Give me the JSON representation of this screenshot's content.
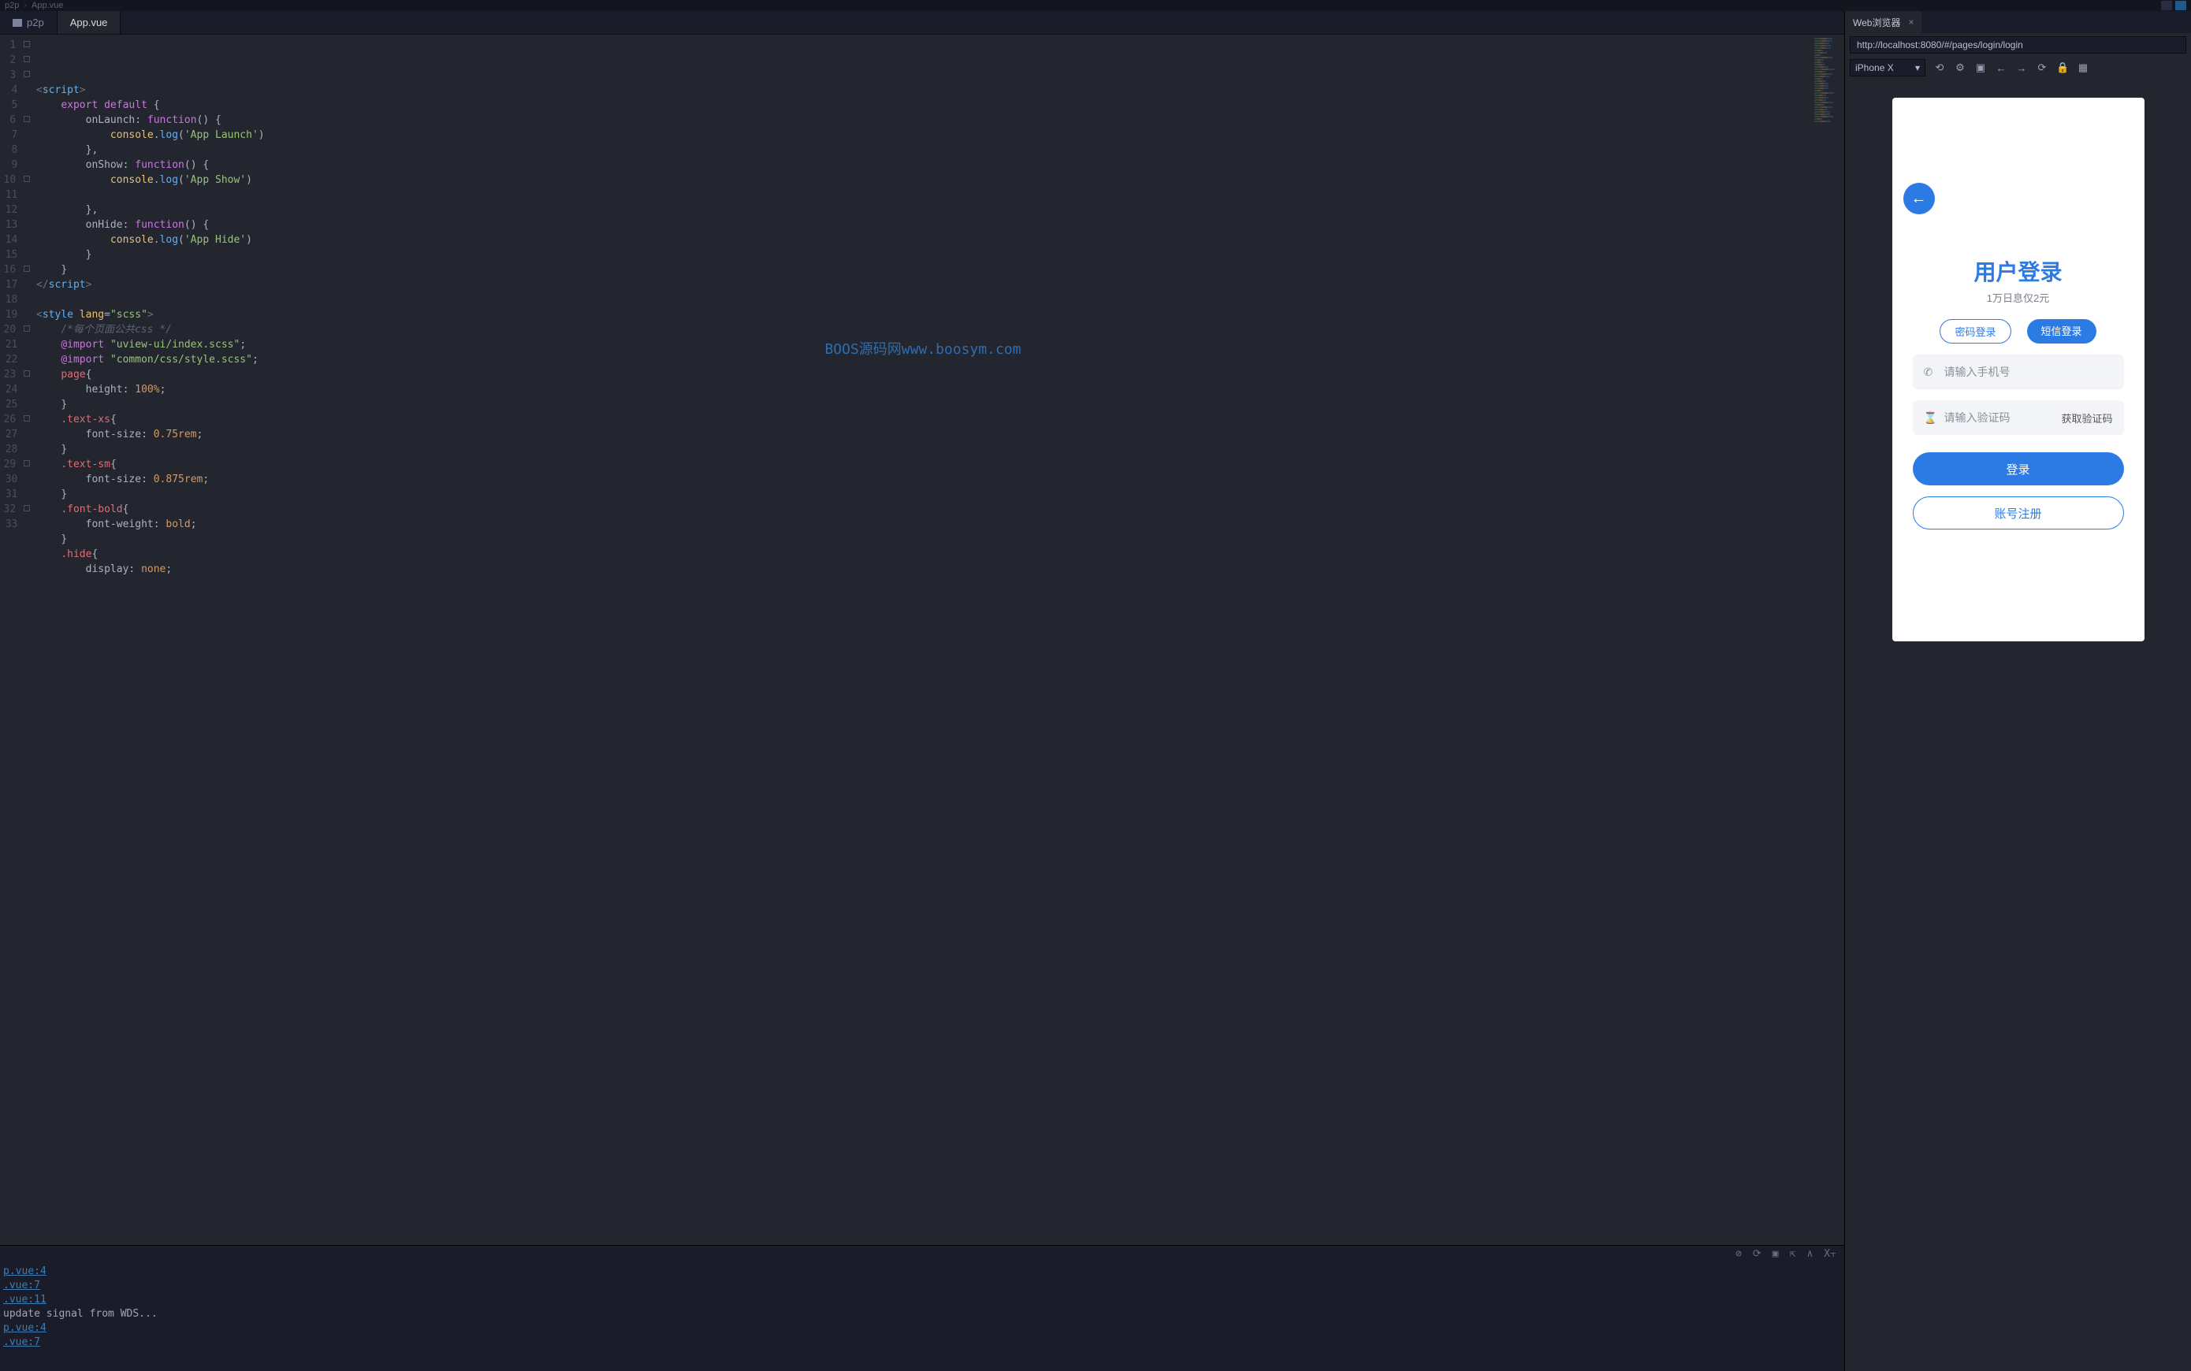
{
  "breadcrumb": {
    "root": "p2p",
    "file": "App.vue"
  },
  "tabs": {
    "items": [
      {
        "label": "p2p",
        "kind": "folder"
      },
      {
        "label": "App.vue",
        "active": true
      }
    ]
  },
  "editor": {
    "lines": [
      {
        "n": 1,
        "fold": true,
        "html": "<span class='tk-angle'>&lt;</span><span class='tk-tag'>script</span><span class='tk-angle'>&gt;</span>"
      },
      {
        "n": 2,
        "fold": true,
        "html": "    <span class='tk-keyword'>export</span> <span class='tk-keyword'>default</span> <span class='tk-punc'>{</span>"
      },
      {
        "n": 3,
        "fold": true,
        "html": "        <span class='tk-prop'>onLaunch</span>: <span class='tk-keyword'>function</span><span class='tk-punc'>() {</span>"
      },
      {
        "n": 4,
        "fold": false,
        "html": "            <span class='tk-builtin'>console</span>.<span class='tk-func'>log</span>(<span class='tk-string'>'App Launch'</span>)"
      },
      {
        "n": 5,
        "fold": false,
        "html": "        <span class='tk-punc'>},</span>"
      },
      {
        "n": 6,
        "fold": true,
        "html": "        <span class='tk-prop'>onShow</span>: <span class='tk-keyword'>function</span><span class='tk-punc'>() {</span>"
      },
      {
        "n": 7,
        "fold": false,
        "html": "            <span class='tk-builtin'>console</span>.<span class='tk-func'>log</span>(<span class='tk-string'>'App Show'</span>)"
      },
      {
        "n": 8,
        "fold": false,
        "html": ""
      },
      {
        "n": 9,
        "fold": false,
        "html": "        <span class='tk-punc'>},</span>"
      },
      {
        "n": 10,
        "fold": true,
        "html": "        <span class='tk-prop'>onHide</span>: <span class='tk-keyword'>function</span><span class='tk-punc'>() {</span>"
      },
      {
        "n": 11,
        "fold": false,
        "html": "            <span class='tk-builtin'>console</span>.<span class='tk-func'>log</span>(<span class='tk-string'>'App Hide'</span>)"
      },
      {
        "n": 12,
        "fold": false,
        "html": "        <span class='tk-punc'>}</span>"
      },
      {
        "n": 13,
        "fold": false,
        "html": "    <span class='tk-punc'>}</span>"
      },
      {
        "n": 14,
        "fold": false,
        "html": "<span class='tk-angle'>&lt;/</span><span class='tk-tag'>script</span><span class='tk-angle'>&gt;</span>"
      },
      {
        "n": 15,
        "fold": false,
        "html": ""
      },
      {
        "n": 16,
        "fold": true,
        "html": "<span class='tk-angle'>&lt;</span><span class='tk-tag'>style</span> <span class='tk-attr-name'>lang</span>=<span class='tk-attr-val'>\"scss\"</span><span class='tk-angle'>&gt;</span>"
      },
      {
        "n": 17,
        "fold": false,
        "html": "    <span class='tk-comment'>/*每个页面公共css */</span>"
      },
      {
        "n": 18,
        "fold": false,
        "html": "    <span class='tk-at'>@import</span> <span class='tk-string'>\"uview-ui/index.scss\"</span>;"
      },
      {
        "n": 19,
        "fold": false,
        "html": "    <span class='tk-at'>@import</span> <span class='tk-string'>\"common/css/style.scss\"</span>;"
      },
      {
        "n": 20,
        "fold": true,
        "html": "    <span class='tk-selector'>page</span><span class='tk-punc'>{</span>"
      },
      {
        "n": 21,
        "fold": false,
        "html": "        <span class='tk-cssprop'>height</span>: <span class='tk-cssval'>100%</span>;"
      },
      {
        "n": 22,
        "fold": false,
        "html": "    <span class='tk-punc'>}</span>"
      },
      {
        "n": 23,
        "fold": true,
        "html": "    <span class='tk-selector'>.text-xs</span><span class='tk-punc'>{</span>"
      },
      {
        "n": 24,
        "fold": false,
        "html": "        <span class='tk-cssprop'>font-size</span>: <span class='tk-cssval'>0.75rem</span>;"
      },
      {
        "n": 25,
        "fold": false,
        "html": "    <span class='tk-punc'>}</span>"
      },
      {
        "n": 26,
        "fold": true,
        "html": "    <span class='tk-selector'>.text-sm</span><span class='tk-punc'>{</span>"
      },
      {
        "n": 27,
        "fold": false,
        "html": "        <span class='tk-cssprop'>font-size</span>: <span class='tk-cssval'>0.875rem</span>;"
      },
      {
        "n": 28,
        "fold": false,
        "html": "    <span class='tk-punc'>}</span>"
      },
      {
        "n": 29,
        "fold": true,
        "html": "    <span class='tk-selector'>.font-bold</span><span class='tk-punc'>{</span>"
      },
      {
        "n": 30,
        "fold": false,
        "html": "        <span class='tk-cssprop'>font-weight</span>: <span class='tk-cssval'>bold</span>;"
      },
      {
        "n": 31,
        "fold": false,
        "html": "    <span class='tk-punc'>}</span>"
      },
      {
        "n": 32,
        "fold": true,
        "html": "    <span class='tk-selector'>.hide</span><span class='tk-punc'>{</span>"
      },
      {
        "n": 33,
        "fold": false,
        "html": "        <span class='tk-cssprop'>display</span>: <span class='tk-cssval'>none</span>;"
      }
    ]
  },
  "watermark": "BOOS源码网www.boosym.com",
  "console": {
    "lines": [
      {
        "type": "link",
        "text": "p.vue:4"
      },
      {
        "type": "link",
        "text": ".vue:7"
      },
      {
        "type": "link",
        "text": ".vue:11"
      },
      {
        "type": "msg",
        "text": "  update signal from WDS..."
      },
      {
        "type": "link",
        "text": "p.vue:4"
      },
      {
        "type": "link",
        "text": ".vue:7"
      }
    ]
  },
  "browser": {
    "tabTitle": "Web浏览器",
    "url": "http://localhost:8080/#/pages/login/login",
    "device": "iPhone X"
  },
  "preview": {
    "title": "用户登录",
    "subtitle": "1万日息仅2元",
    "tabPassword": "密码登录",
    "tabSms": "短信登录",
    "phonePlaceholder": "请输入手机号",
    "codePlaceholder": "请输入验证码",
    "getCode": "获取验证码",
    "loginBtn": "登录",
    "registerBtn": "账号注册"
  }
}
